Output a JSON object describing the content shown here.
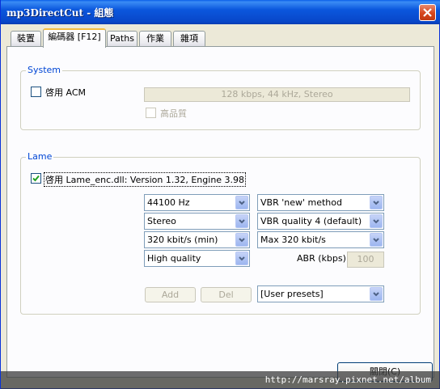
{
  "window": {
    "title": "mp3DirectCut - 組態"
  },
  "tabs": [
    {
      "label": "裝置"
    },
    {
      "label": "編碼器 [F12]"
    },
    {
      "label": "Paths"
    },
    {
      "label": "作業"
    },
    {
      "label": "雜項"
    }
  ],
  "active_tab": "編碼器 [F12]",
  "system_group": {
    "label": "System",
    "enable_acm_label": "啓用 ACM",
    "enable_acm_checked": false,
    "acm_format": "128 kbps, 44 kHz, Stereo",
    "high_quality_label": "高品質",
    "high_quality_checked": false
  },
  "lame_group": {
    "label": "Lame",
    "enable_lame_label": "啓用 Lame_enc.dll: Version 1.32, Engine 3.98",
    "enable_lame_checked": true,
    "sample_rate": "44100 Hz",
    "channel_mode": "Stereo",
    "min_bitrate": "320 kbit/s (min)",
    "quality": "High quality",
    "vbr_method": "VBR 'new' method",
    "vbr_quality": "VBR quality 4 (default)",
    "max_bitrate": "Max 320 kbit/s",
    "abr_label": "ABR (kbps):",
    "abr_value": "100",
    "add_label": "Add",
    "del_label": "Del",
    "presets": "[User presets]"
  },
  "close_button": {
    "label": "關閉(C)"
  },
  "watermark": "http://marsray.pixnet.net/album",
  "colors": {
    "titlebar": "#0a55d7",
    "group_label": "#0046d5",
    "active_tab_accent": "#f3bc3f"
  }
}
